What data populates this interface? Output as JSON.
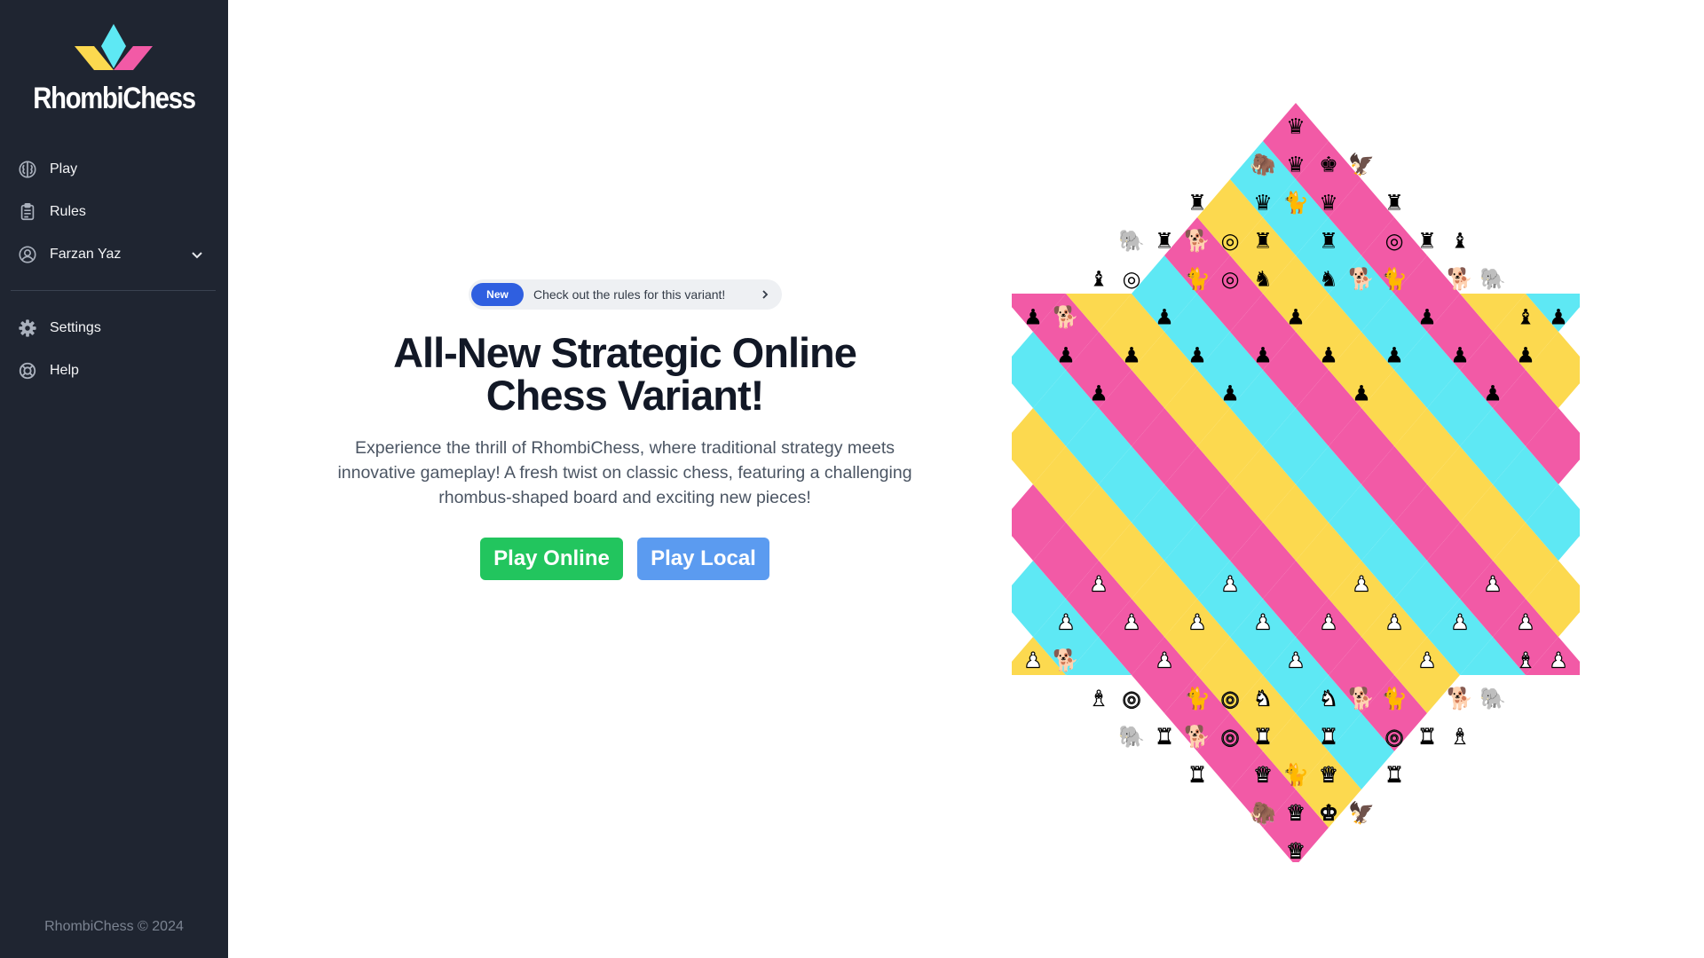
{
  "app": {
    "brand": "RhombiChess",
    "footer": "RhombiChess © 2024",
    "colors": {
      "sidebar": "#1f2531",
      "yellow": "#fcd94f",
      "cyan": "#5ee8f4",
      "pink": "#f25aa6",
      "badge_new": "#2f5fe0",
      "play_online": "#22c55e",
      "play_local": "#5b9bf0"
    }
  },
  "sidebar": {
    "items": [
      {
        "label": "Play",
        "icon": "brain-icon"
      },
      {
        "label": "Rules",
        "icon": "clipboard-icon"
      },
      {
        "label": "Farzan Yaz",
        "icon": "user-circle-icon",
        "expandable": true
      }
    ],
    "secondary": [
      {
        "label": "Settings",
        "icon": "gear-icon"
      },
      {
        "label": "Help",
        "icon": "lifebuoy-icon"
      }
    ]
  },
  "hero": {
    "badge_new": "New",
    "badge_text": "Check out the rules for this variant!",
    "title_line1": "All-New Strategic Online",
    "title_line2": "Chess Variant!",
    "description": "Experience the thrill of RhombiChess, where traditional strategy meets innovative gameplay! A fresh twist on classic chess, featuring a challenging rhombus-shaped board and exciting new pieces!",
    "play_online": "Play Online",
    "play_local": "Play Local"
  },
  "board": {
    "shape": "hexagon of triangular cells colored in yellow, cyan and pink rhombi",
    "piece_sides": [
      "black (top)",
      "white (bottom)"
    ],
    "piece_types": [
      "king",
      "queen",
      "rook",
      "bishop",
      "knight",
      "pawn",
      "dog",
      "cat",
      "elephant",
      "mammoth",
      "eagle",
      "wheel",
      "general",
      "twin"
    ],
    "pieces": [
      {
        "type": "twin",
        "color": "black",
        "cell": [
          0,
          0
        ]
      },
      {
        "type": "mammoth",
        "color": "black",
        "cell": [
          1,
          -1
        ]
      },
      {
        "type": "queen",
        "color": "black",
        "cell": [
          1,
          0
        ]
      },
      {
        "type": "king",
        "color": "black",
        "cell": [
          1,
          1
        ]
      },
      {
        "type": "eagle",
        "color": "black",
        "cell": [
          1,
          2
        ]
      },
      {
        "type": "rook",
        "color": "black",
        "cell": [
          2,
          -3
        ]
      },
      {
        "type": "twin",
        "color": "black",
        "cell": [
          2,
          -1
        ]
      },
      {
        "type": "cat",
        "color": "black",
        "cell": [
          2,
          0
        ]
      },
      {
        "type": "twin",
        "color": "black",
        "cell": [
          2,
          1
        ]
      },
      {
        "type": "rook",
        "color": "black",
        "cell": [
          2,
          3
        ]
      },
      {
        "type": "general",
        "color": "black",
        "cell": [
          3,
          -4
        ]
      },
      {
        "type": "dog",
        "color": "black",
        "cell": [
          3,
          -3
        ]
      },
      {
        "type": "wheel",
        "color": "black",
        "cell": [
          3,
          -2
        ]
      },
      {
        "type": "general",
        "color": "black",
        "cell": [
          3,
          -1
        ]
      },
      {
        "type": "general",
        "color": "black",
        "cell": [
          3,
          1
        ]
      },
      {
        "type": "wheel",
        "color": "black",
        "cell": [
          3,
          3
        ]
      },
      {
        "type": "general",
        "color": "black",
        "cell": [
          3,
          4
        ]
      },
      {
        "type": "bishop",
        "color": "black",
        "cell": [
          3,
          5
        ]
      },
      {
        "type": "elephant",
        "color": "black",
        "cell": [
          3,
          -5
        ]
      },
      {
        "type": "bishop",
        "color": "black",
        "cell": [
          4,
          -6
        ]
      },
      {
        "type": "wheel",
        "color": "black",
        "cell": [
          4,
          -5
        ]
      },
      {
        "type": "cat",
        "color": "black",
        "cell": [
          4,
          -3
        ]
      },
      {
        "type": "wheel",
        "color": "black",
        "cell": [
          4,
          -2
        ]
      },
      {
        "type": "knight",
        "color": "black",
        "cell": [
          4,
          -1
        ]
      },
      {
        "type": "knight",
        "color": "black",
        "cell": [
          4,
          1
        ]
      },
      {
        "type": "dog",
        "color": "black",
        "cell": [
          4,
          2
        ]
      },
      {
        "type": "cat",
        "color": "black",
        "cell": [
          4,
          3
        ]
      },
      {
        "type": "dog",
        "color": "black",
        "cell": [
          4,
          5
        ]
      },
      {
        "type": "elephant",
        "color": "black",
        "cell": [
          4,
          6
        ]
      },
      {
        "type": "dog",
        "color": "black",
        "cell": [
          5,
          -7
        ]
      },
      {
        "type": "bishop",
        "color": "black",
        "cell": [
          5,
          7
        ]
      },
      {
        "type": "pawn",
        "color": "black",
        "cell": [
          5,
          -8
        ]
      },
      {
        "type": "pawn",
        "color": "black",
        "cell": [
          5,
          -4
        ]
      },
      {
        "type": "pawn",
        "color": "black",
        "cell": [
          5,
          0
        ]
      },
      {
        "type": "pawn",
        "color": "black",
        "cell": [
          5,
          4
        ]
      },
      {
        "type": "pawn",
        "color": "black",
        "cell": [
          5,
          8
        ]
      },
      {
        "type": "pawn",
        "color": "black",
        "cell": [
          6,
          -7
        ]
      },
      {
        "type": "pawn",
        "color": "black",
        "cell": [
          6,
          -5
        ]
      },
      {
        "type": "pawn",
        "color": "black",
        "cell": [
          6,
          -3
        ]
      },
      {
        "type": "pawn",
        "color": "black",
        "cell": [
          6,
          -1
        ]
      },
      {
        "type": "pawn",
        "color": "black",
        "cell": [
          6,
          1
        ]
      },
      {
        "type": "pawn",
        "color": "black",
        "cell": [
          6,
          3
        ]
      },
      {
        "type": "pawn",
        "color": "black",
        "cell": [
          6,
          5
        ]
      },
      {
        "type": "pawn",
        "color": "black",
        "cell": [
          6,
          7
        ]
      },
      {
        "type": "pawn",
        "color": "black",
        "cell": [
          7,
          -6
        ]
      },
      {
        "type": "pawn",
        "color": "black",
        "cell": [
          7,
          -2
        ]
      },
      {
        "type": "pawn",
        "color": "black",
        "cell": [
          7,
          2
        ]
      },
      {
        "type": "pawn",
        "color": "black",
        "cell": [
          7,
          6
        ]
      },
      {
        "type": "twin",
        "color": "white",
        "cell": [
          19,
          0
        ]
      },
      {
        "type": "mammoth",
        "color": "white",
        "cell": [
          18,
          -1
        ]
      },
      {
        "type": "queen",
        "color": "white",
        "cell": [
          18,
          0
        ]
      },
      {
        "type": "king",
        "color": "white",
        "cell": [
          18,
          1
        ]
      },
      {
        "type": "eagle",
        "color": "white",
        "cell": [
          18,
          2
        ]
      },
      {
        "type": "rook",
        "color": "white",
        "cell": [
          17,
          -3
        ]
      },
      {
        "type": "twin",
        "color": "white",
        "cell": [
          17,
          -1
        ]
      },
      {
        "type": "cat",
        "color": "white",
        "cell": [
          17,
          0
        ]
      },
      {
        "type": "twin",
        "color": "white",
        "cell": [
          17,
          1
        ]
      },
      {
        "type": "rook",
        "color": "white",
        "cell": [
          17,
          3
        ]
      },
      {
        "type": "general",
        "color": "white",
        "cell": [
          16,
          -4
        ]
      },
      {
        "type": "dog",
        "color": "white",
        "cell": [
          16,
          -3
        ]
      },
      {
        "type": "wheel",
        "color": "white",
        "cell": [
          16,
          -2
        ]
      },
      {
        "type": "general",
        "color": "white",
        "cell": [
          16,
          -1
        ]
      },
      {
        "type": "general",
        "color": "white",
        "cell": [
          16,
          1
        ]
      },
      {
        "type": "wheel",
        "color": "white",
        "cell": [
          16,
          3
        ]
      },
      {
        "type": "general",
        "color": "white",
        "cell": [
          16,
          4
        ]
      },
      {
        "type": "bishop",
        "color": "white",
        "cell": [
          16,
          5
        ]
      },
      {
        "type": "elephant",
        "color": "white",
        "cell": [
          16,
          -5
        ]
      },
      {
        "type": "bishop",
        "color": "white",
        "cell": [
          15,
          -6
        ]
      },
      {
        "type": "wheel",
        "color": "white",
        "cell": [
          15,
          -5
        ]
      },
      {
        "type": "cat",
        "color": "white",
        "cell": [
          15,
          -3
        ]
      },
      {
        "type": "wheel",
        "color": "white",
        "cell": [
          15,
          -2
        ]
      },
      {
        "type": "knight",
        "color": "white",
        "cell": [
          15,
          -1
        ]
      },
      {
        "type": "knight",
        "color": "white",
        "cell": [
          15,
          1
        ]
      },
      {
        "type": "dog",
        "color": "white",
        "cell": [
          15,
          2
        ]
      },
      {
        "type": "cat",
        "color": "white",
        "cell": [
          15,
          3
        ]
      },
      {
        "type": "dog",
        "color": "white",
        "cell": [
          15,
          5
        ]
      },
      {
        "type": "elephant",
        "color": "white",
        "cell": [
          15,
          6
        ]
      },
      {
        "type": "dog",
        "color": "white",
        "cell": [
          14,
          -7
        ]
      },
      {
        "type": "bishop",
        "color": "white",
        "cell": [
          14,
          7
        ]
      },
      {
        "type": "pawn",
        "color": "white",
        "cell": [
          14,
          -8
        ]
      },
      {
        "type": "pawn",
        "color": "white",
        "cell": [
          14,
          -4
        ]
      },
      {
        "type": "pawn",
        "color": "white",
        "cell": [
          14,
          0
        ]
      },
      {
        "type": "pawn",
        "color": "white",
        "cell": [
          14,
          4
        ]
      },
      {
        "type": "pawn",
        "color": "white",
        "cell": [
          14,
          8
        ]
      },
      {
        "type": "pawn",
        "color": "white",
        "cell": [
          13,
          -7
        ]
      },
      {
        "type": "pawn",
        "color": "white",
        "cell": [
          13,
          -5
        ]
      },
      {
        "type": "pawn",
        "color": "white",
        "cell": [
          13,
          -3
        ]
      },
      {
        "type": "pawn",
        "color": "white",
        "cell": [
          13,
          -1
        ]
      },
      {
        "type": "pawn",
        "color": "white",
        "cell": [
          13,
          1
        ]
      },
      {
        "type": "pawn",
        "color": "white",
        "cell": [
          13,
          3
        ]
      },
      {
        "type": "pawn",
        "color": "white",
        "cell": [
          13,
          5
        ]
      },
      {
        "type": "pawn",
        "color": "white",
        "cell": [
          13,
          7
        ]
      },
      {
        "type": "pawn",
        "color": "white",
        "cell": [
          12,
          -6
        ]
      },
      {
        "type": "pawn",
        "color": "white",
        "cell": [
          12,
          -2
        ]
      },
      {
        "type": "pawn",
        "color": "white",
        "cell": [
          12,
          2
        ]
      },
      {
        "type": "pawn",
        "color": "white",
        "cell": [
          12,
          6
        ]
      }
    ]
  }
}
